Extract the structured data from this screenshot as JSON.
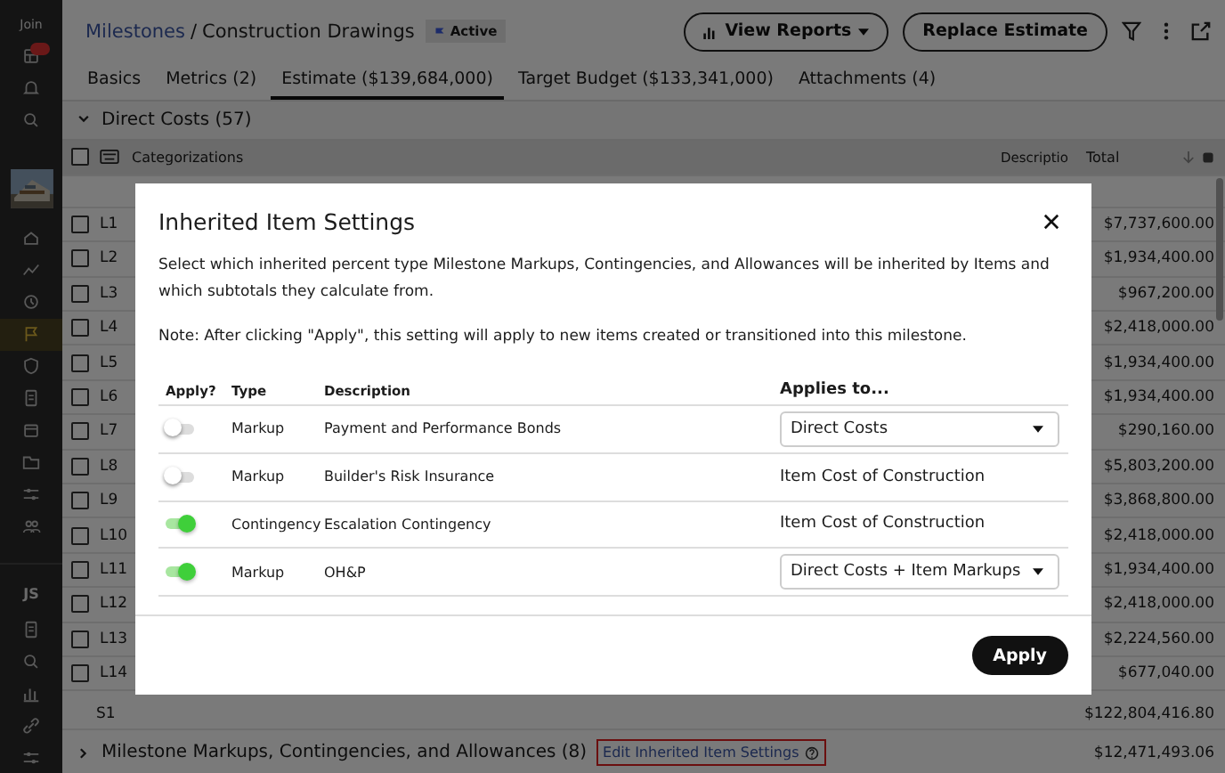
{
  "sidebar": {
    "org": "Join",
    "top_items": [
      {
        "kind": "grid",
        "badge": true
      },
      {
        "kind": "bell",
        "badge": false
      },
      {
        "kind": "search",
        "badge": false
      }
    ],
    "nav_items": [
      {
        "kind": "home",
        "selected": false
      },
      {
        "kind": "trend",
        "selected": false
      },
      {
        "kind": "clock",
        "selected": false
      },
      {
        "kind": "flag",
        "selected": true
      },
      {
        "kind": "shield",
        "selected": false
      },
      {
        "kind": "doc",
        "selected": false
      },
      {
        "kind": "calendar",
        "selected": false
      },
      {
        "kind": "folder",
        "selected": false
      },
      {
        "kind": "sliders",
        "selected": false
      },
      {
        "kind": "people",
        "selected": false
      }
    ],
    "user": "JS",
    "bottom_items": [
      {
        "kind": "doc"
      },
      {
        "kind": "search"
      },
      {
        "kind": "chart"
      },
      {
        "kind": "link"
      },
      {
        "kind": "sliders"
      }
    ]
  },
  "header": {
    "breadcrumb_link": "Milestones",
    "breadcrumb_separator": "/",
    "breadcrumb_current": "Construction Drawings",
    "status": "Active",
    "buttons": [
      {
        "label": "View Reports",
        "kind": "reports"
      },
      {
        "label": "Replace Estimate",
        "kind": "plain"
      }
    ]
  },
  "tabs": [
    {
      "label": "Basics",
      "selected": false
    },
    {
      "label": "Metrics (2)",
      "selected": false
    },
    {
      "label": "Estimate ($139,684,000)",
      "selected": true
    },
    {
      "label": "Target Budget ($133,341,000)",
      "selected": false
    },
    {
      "label": "Attachments (4)",
      "selected": false
    }
  ],
  "section": {
    "title": "Direct Costs (57)",
    "expanded": true
  },
  "table": {
    "all_checked": false,
    "columns": [
      "Categorizations",
      "Descriptio",
      "Total"
    ],
    "rows": [
      {
        "id": "L1",
        "checked": false,
        "total": "$7,737,600.00"
      },
      {
        "id": "L2",
        "checked": false,
        "total": "$1,934,400.00"
      },
      {
        "id": "L3",
        "checked": false,
        "total": "$967,200.00"
      },
      {
        "id": "L4",
        "checked": false,
        "total": "$2,418,000.00"
      },
      {
        "id": "L5",
        "checked": false,
        "total": "$1,934,400.00"
      },
      {
        "id": "L6",
        "checked": false,
        "total": "$1,934,400.00"
      },
      {
        "id": "L7",
        "checked": false,
        "total": "$290,160.00"
      },
      {
        "id": "L8",
        "checked": false,
        "total": "$5,803,200.00"
      },
      {
        "id": "L9",
        "checked": false,
        "total": "$3,868,800.00"
      },
      {
        "id": "L10",
        "checked": false,
        "total": "$2,418,000.00"
      },
      {
        "id": "L11",
        "checked": false,
        "total": "$1,934,400.00"
      },
      {
        "id": "L12",
        "checked": false,
        "total": "$2,418,000.00"
      },
      {
        "id": "L13",
        "checked": false,
        "total": "$2,224,560.00"
      },
      {
        "id": "L14",
        "checked": false,
        "total": "$677,040.00"
      }
    ],
    "subtotal": {
      "id": "S1",
      "total": "$122,804,416.80"
    }
  },
  "bottom_section": {
    "title": "Milestone Markups, Contingencies, and Allowances (8)",
    "expanded": false,
    "link": "Edit Inherited Item Settings",
    "total": "$12,471,493.06"
  },
  "modal": {
    "title": "Inherited Item Settings",
    "description": "Select which inherited percent type Milestone Markups, Contingencies, and Allowances will be inherited by Items and which subtotals they calculate from.",
    "note": "Note: After clicking \"Apply\", this setting will apply to new items created or transitioned into this milestone.",
    "columns": [
      "Apply?",
      "Type",
      "Description",
      "Applies to..."
    ],
    "rows": [
      {
        "on": false,
        "type": "Markup",
        "description": "Payment and Performance Bonds",
        "applies_to": {
          "kind": "dropdown",
          "value": "Direct Costs"
        }
      },
      {
        "on": false,
        "type": "Markup",
        "description": "Builder's Risk Insurance",
        "applies_to": {
          "kind": "text",
          "value": "Item Cost of Construction"
        }
      },
      {
        "on": true,
        "type": "Contingency",
        "description": "Escalation Contingency",
        "applies_to": {
          "kind": "text",
          "value": "Item Cost of Construction"
        }
      },
      {
        "on": true,
        "type": "Markup",
        "description": "OH&P",
        "applies_to": {
          "kind": "dropdown",
          "value": "Direct Costs + Item Markups"
        }
      }
    ],
    "button": "Apply"
  }
}
